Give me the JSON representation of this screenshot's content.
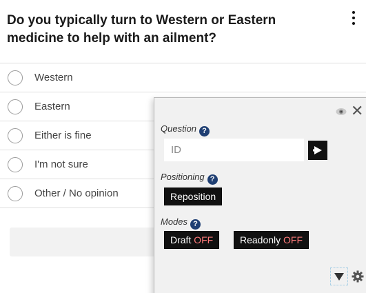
{
  "question": {
    "title": "Do you typically turn to Western or Eastern medicine to help with an ailment?",
    "menu_icon": "kebab-menu-icon"
  },
  "options": [
    {
      "label": "Western"
    },
    {
      "label": "Eastern"
    },
    {
      "label": "Either is fine"
    },
    {
      "label": "I'm not sure"
    },
    {
      "label": "Other / No opinion"
    }
  ],
  "panel": {
    "question_label": "Question",
    "id_placeholder": "ID",
    "positioning_label": "Positioning",
    "reposition_label": "Reposition",
    "modes_label": "Modes",
    "draft_label": "Draft",
    "draft_state": "OFF",
    "readonly_label": "Readonly",
    "readonly_state": "OFF",
    "help_glyph": "?",
    "close_glyph": "✕",
    "icons": [
      "eye-icon",
      "close-icon",
      "help-icon",
      "arrow-right-icon",
      "down-arrow-icon",
      "gear-icon"
    ],
    "colors": {
      "panel_bg": "#f1f1f1",
      "button_bg": "#111111",
      "off_text": "#ff7a7a",
      "help_bg": "#1f3f73"
    }
  }
}
